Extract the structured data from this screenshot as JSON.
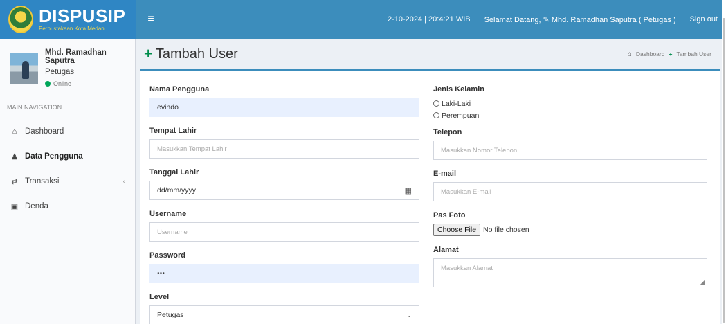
{
  "header": {
    "logo_title": "DISPUSIP",
    "logo_subtitle": "Perpustakaan Kota Medan",
    "toggle_icon": "hamburger-icon",
    "datetime": "2-10-2024 | 20:4:21 WIB",
    "welcome": "Selamat Datang, ✎ Mhd. Ramadhan Saputra ( Petugas )",
    "signout": "Sign out"
  },
  "sidebar": {
    "user": {
      "name": "Mhd. Ramadhan Saputra",
      "role": "Petugas",
      "status": "Online"
    },
    "nav_header": "MAIN NAVIGATION",
    "items": [
      {
        "label": "Dashboard",
        "icon": "dashboard-icon"
      },
      {
        "label": "Data Pengguna",
        "icon": "user-icon"
      },
      {
        "label": "Transaksi",
        "icon": "exchange-icon"
      },
      {
        "label": "Denda",
        "icon": "money-icon"
      }
    ]
  },
  "page": {
    "title": "Tambah User",
    "breadcrumb": [
      "Dashboard",
      "Tambah User"
    ]
  },
  "form": {
    "nama_label": "Nama Pengguna",
    "nama_value": "evindo",
    "tempat_label": "Tempat Lahir",
    "tempat_placeholder": "Masukkan Tempat Lahir",
    "tanggal_label": "Tanggal Lahir",
    "tanggal_placeholder": "dd/mm/yyyy",
    "username_label": "Username",
    "username_placeholder": "Username",
    "password_label": "Password",
    "password_value": "•••",
    "level_label": "Level",
    "level_value": "Petugas",
    "jk_label": "Jenis Kelamin",
    "jk_options": [
      "Laki-Laki",
      "Perempuan"
    ],
    "telepon_label": "Telepon",
    "telepon_placeholder": "Masukkan Nomor Telepon",
    "email_label": "E-mail",
    "email_placeholder": "Masukkan E-mail",
    "foto_label": "Pas Foto",
    "foto_button": "Choose File",
    "foto_status": "No file chosen",
    "alamat_label": "Alamat",
    "alamat_placeholder": "Masukkan Alamat"
  }
}
